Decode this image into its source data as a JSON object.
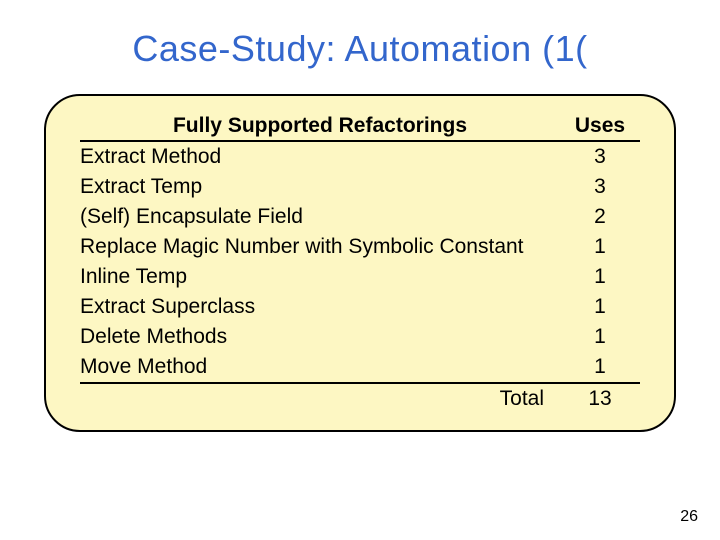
{
  "title": "Case-Study: Automation (1(",
  "headers": {
    "name": "Fully Supported Refactorings",
    "uses": "Uses"
  },
  "rows": [
    {
      "name": "Extract Method",
      "uses": "3"
    },
    {
      "name": "Extract Temp",
      "uses": "3"
    },
    {
      "name": "(Self) Encapsulate Field",
      "uses": "2"
    },
    {
      "name": "Replace Magic Number with Symbolic Constant",
      "uses": "1"
    },
    {
      "name": "Inline Temp",
      "uses": "1"
    },
    {
      "name": "Extract Superclass",
      "uses": "1"
    },
    {
      "name": "Delete Methods",
      "uses": "1"
    },
    {
      "name": "Move Method",
      "uses": "1"
    }
  ],
  "total": {
    "label": "Total",
    "value": "13"
  },
  "page_number": "26",
  "chart_data": {
    "type": "table",
    "title": "Fully Supported Refactorings — Uses",
    "columns": [
      "Fully Supported Refactorings",
      "Uses"
    ],
    "rows": [
      [
        "Extract Method",
        3
      ],
      [
        "Extract Temp",
        3
      ],
      [
        "(Self) Encapsulate Field",
        2
      ],
      [
        "Replace Magic Number with Symbolic Constant",
        1
      ],
      [
        "Inline Temp",
        1
      ],
      [
        "Extract Superclass",
        1
      ],
      [
        "Delete Methods",
        1
      ],
      [
        "Move Method",
        1
      ]
    ],
    "total": 13
  }
}
